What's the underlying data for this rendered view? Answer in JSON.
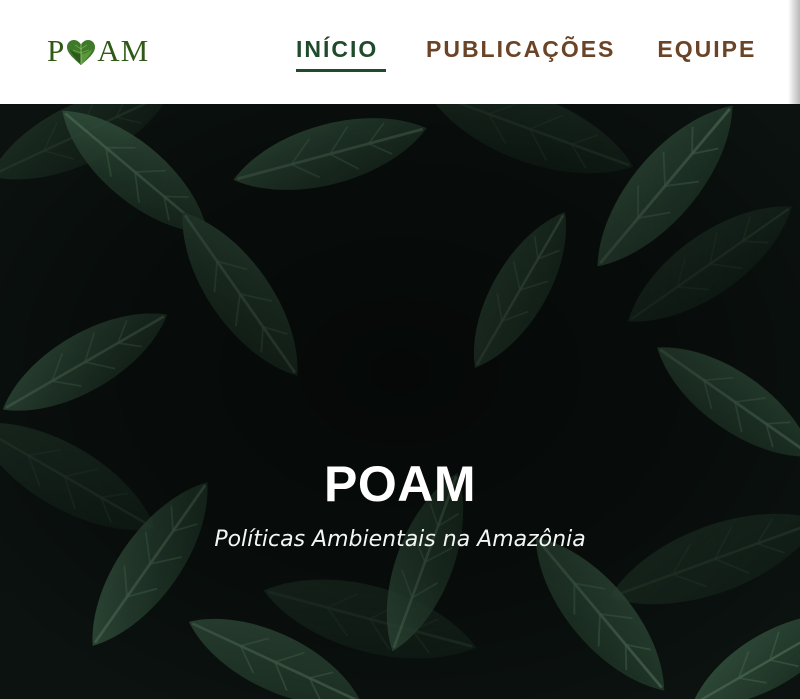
{
  "brand": {
    "logo_text_before": "P",
    "logo_text_after": "AM",
    "logo_icon": "leaf-heart-icon"
  },
  "nav": {
    "items": [
      {
        "label": "INÍCIO",
        "active": true
      },
      {
        "label": "PUBLICAÇÕES",
        "active": false
      },
      {
        "label": "EQUIPE",
        "active": false
      }
    ]
  },
  "hero": {
    "title": "POAM",
    "subtitle": "Políticas Ambientais na Amazônia",
    "background": "dark-green-leaves-photo"
  },
  "colors": {
    "header_bg": "#ffffff",
    "nav_active": "#1f4a2c",
    "nav_inactive": "#6b4327",
    "logo": "#2f5a16",
    "hero_text": "#ffffff"
  }
}
